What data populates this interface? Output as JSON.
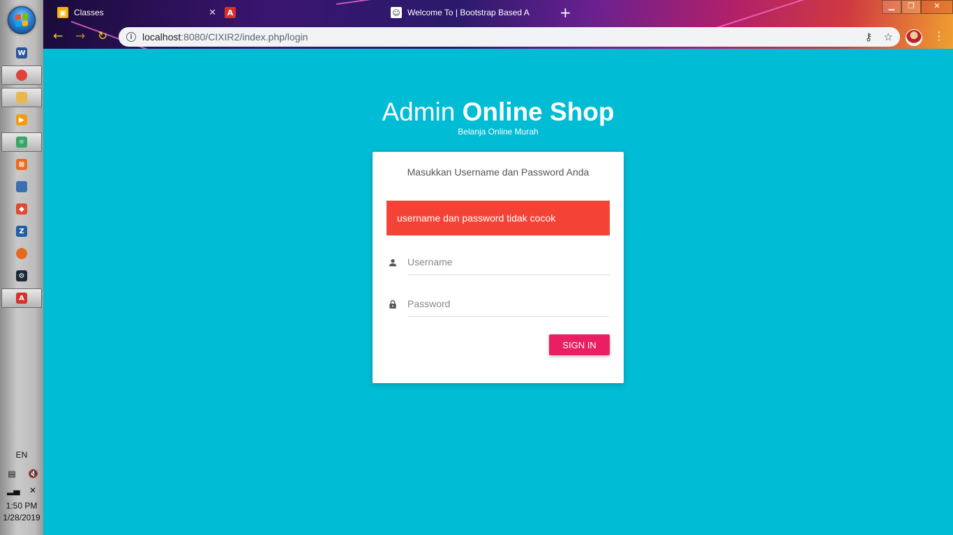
{
  "taskbar": {
    "apps": [
      {
        "name": "word-icon",
        "label": "W",
        "color": "#2b579a"
      },
      {
        "name": "chrome-icon",
        "label": "",
        "color": "#e0413a"
      },
      {
        "name": "file-explorer-icon",
        "label": "",
        "color": "#e8b84a"
      },
      {
        "name": "media-player-icon",
        "label": "▶",
        "color": "#f39c12"
      },
      {
        "name": "atom-icon",
        "label": "⚛",
        "color": "#3aa56a"
      },
      {
        "name": "xampp-icon",
        "label": "⊠",
        "color": "#f06a1e"
      },
      {
        "name": "virtualbox-icon",
        "label": "",
        "color": "#3a6fb5"
      },
      {
        "name": "git-icon",
        "label": "◆",
        "color": "#e04a30"
      },
      {
        "name": "filezilla-icon",
        "label": "Z",
        "color": "#1e5fa8"
      },
      {
        "name": "firefox-icon",
        "label": "",
        "color": "#e66a1e"
      },
      {
        "name": "steam-icon",
        "label": "⚙",
        "color": "#1b2838"
      },
      {
        "name": "acrobat-icon",
        "label": "A",
        "color": "#d8302a"
      }
    ],
    "language": "EN",
    "time": "1:50 PM",
    "date": "1/28/2019"
  },
  "browser": {
    "tabs": [
      {
        "title": "Classes",
        "fav_color": "#f4b400",
        "fav_text": ""
      },
      {
        "title": "",
        "fav_color": "#d8302a",
        "fav_text": "A"
      },
      {
        "title": "Welcome To | Bootstrap Based A",
        "fav_color": "#ffffff",
        "fav_text": ""
      }
    ],
    "url_host": "localhost",
    "url_path": ":8080/CIXIR2/index.php/login"
  },
  "login": {
    "title_light": "Admin ",
    "title_bold": "Online Shop",
    "subtitle": "Belanja Online Murah",
    "message": "Masukkan Username dan Password Anda",
    "error": "username dan password tidak cocok",
    "username_placeholder": "Username",
    "password_placeholder": "Password",
    "signin_label": "SIGN IN"
  },
  "colors": {
    "page_bg": "#00bcd4",
    "alert_bg": "#f44336",
    "button_bg": "#e91e63"
  }
}
